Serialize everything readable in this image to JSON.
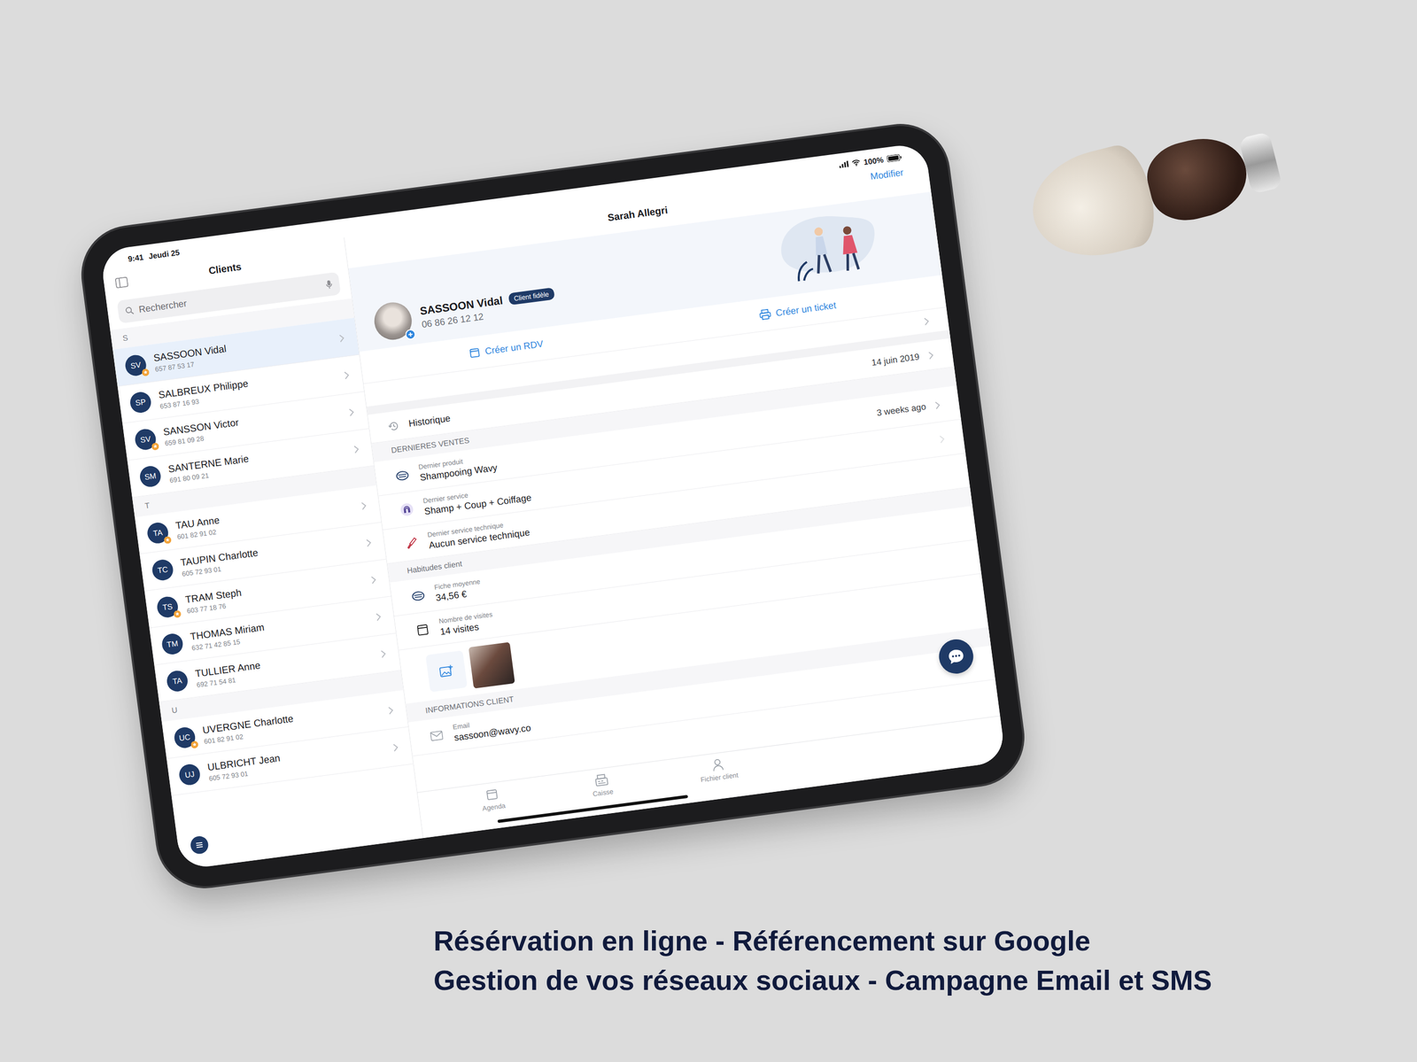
{
  "status_bar": {
    "time": "9:41",
    "date": "Jeudi 25",
    "battery": "100%"
  },
  "sidebar": {
    "title": "Clients",
    "search_placeholder": "Rechercher",
    "sections": [
      {
        "letter": "S",
        "clients": [
          {
            "initials": "SV",
            "name": "SASSOON Vidal",
            "phone": "657 87 53 17",
            "starred": true,
            "selected": true
          },
          {
            "initials": "SP",
            "name": "SALBREUX Philippe",
            "phone": "653 87 16 93",
            "starred": false,
            "selected": false
          },
          {
            "initials": "SV",
            "name": "SANSSON Victor",
            "phone": "659 81 09 28",
            "starred": true,
            "selected": false
          },
          {
            "initials": "SM",
            "name": "SANTERNE Marie",
            "phone": "691 80 09 21",
            "starred": false,
            "selected": false
          }
        ]
      },
      {
        "letter": "T",
        "clients": [
          {
            "initials": "TA",
            "name": "TAU Anne",
            "phone": "601 82 91 02",
            "starred": true,
            "selected": false
          },
          {
            "initials": "TC",
            "name": "TAUPIN Charlotte",
            "phone": "605 72 93 01",
            "starred": false,
            "selected": false
          },
          {
            "initials": "TS",
            "name": "TRAM Steph",
            "phone": "603 77 18 76",
            "starred": true,
            "selected": false
          },
          {
            "initials": "TM",
            "name": "THOMAS Miriam",
            "phone": "632 71 42 85 15",
            "starred": false,
            "selected": false
          },
          {
            "initials": "TA",
            "name": "TULLIER Anne",
            "phone": "692 71 54 81",
            "starred": false,
            "selected": false
          }
        ]
      },
      {
        "letter": "U",
        "clients": [
          {
            "initials": "UC",
            "name": "UVERGNE Charlotte",
            "phone": "601 82 91 02",
            "starred": true,
            "selected": false
          },
          {
            "initials": "UJ",
            "name": "ULBRICHT Jean",
            "phone": "605 72 93 01",
            "starred": false,
            "selected": false
          }
        ]
      }
    ]
  },
  "detail": {
    "nav_title": "Sarah Allegri",
    "edit": "Modifier",
    "client": {
      "name": "SASSOON Vidal",
      "badge": "Client fidèle",
      "phone": "06 86 26 12 12"
    },
    "actions": [
      {
        "label": "Créer un RDV",
        "kind": "calendar"
      },
      {
        "label": "Créer un ticket",
        "kind": "printer"
      }
    ],
    "history": {
      "label": "Historique",
      "date": "14 juin 2019"
    },
    "sales": {
      "header": "DERNIERES VENTES",
      "rows": [
        {
          "kind": "product",
          "label": "Dernier produit",
          "value": "Shampooing Wavy",
          "meta": "3 weeks ago",
          "chevron": true
        },
        {
          "kind": "service",
          "label": "Dernier service",
          "value": "Shamp + Coup + Coiffage",
          "meta": "",
          "chevron": true
        },
        {
          "kind": "technical",
          "label": "Dernier service technique",
          "value": "Aucun service technique",
          "meta": "",
          "chevron": false
        }
      ]
    },
    "habits": {
      "header": "Habitudes client",
      "rows": [
        {
          "kind": "ticket",
          "label": "Fiche moyenne",
          "value": "34,56 €"
        },
        {
          "kind": "visits",
          "label": "Nombre de visites",
          "value": "14 visites"
        }
      ]
    },
    "info": {
      "header": "INFORMATIONS CLIENT",
      "rows": [
        {
          "label": "Email",
          "value": "sassoon@wavy.co"
        }
      ]
    }
  },
  "tab_bar": [
    {
      "label": "Agenda",
      "kind": "agenda",
      "selected": false
    },
    {
      "label": "Caisse",
      "kind": "register",
      "selected": false
    },
    {
      "label": "Fichier client",
      "kind": "person",
      "selected": false
    }
  ],
  "caption": [
    "Résérvation en ligne - Référencement sur Google",
    "Gestion de vos réseaux sociaux - Campagne Email et SMS"
  ]
}
